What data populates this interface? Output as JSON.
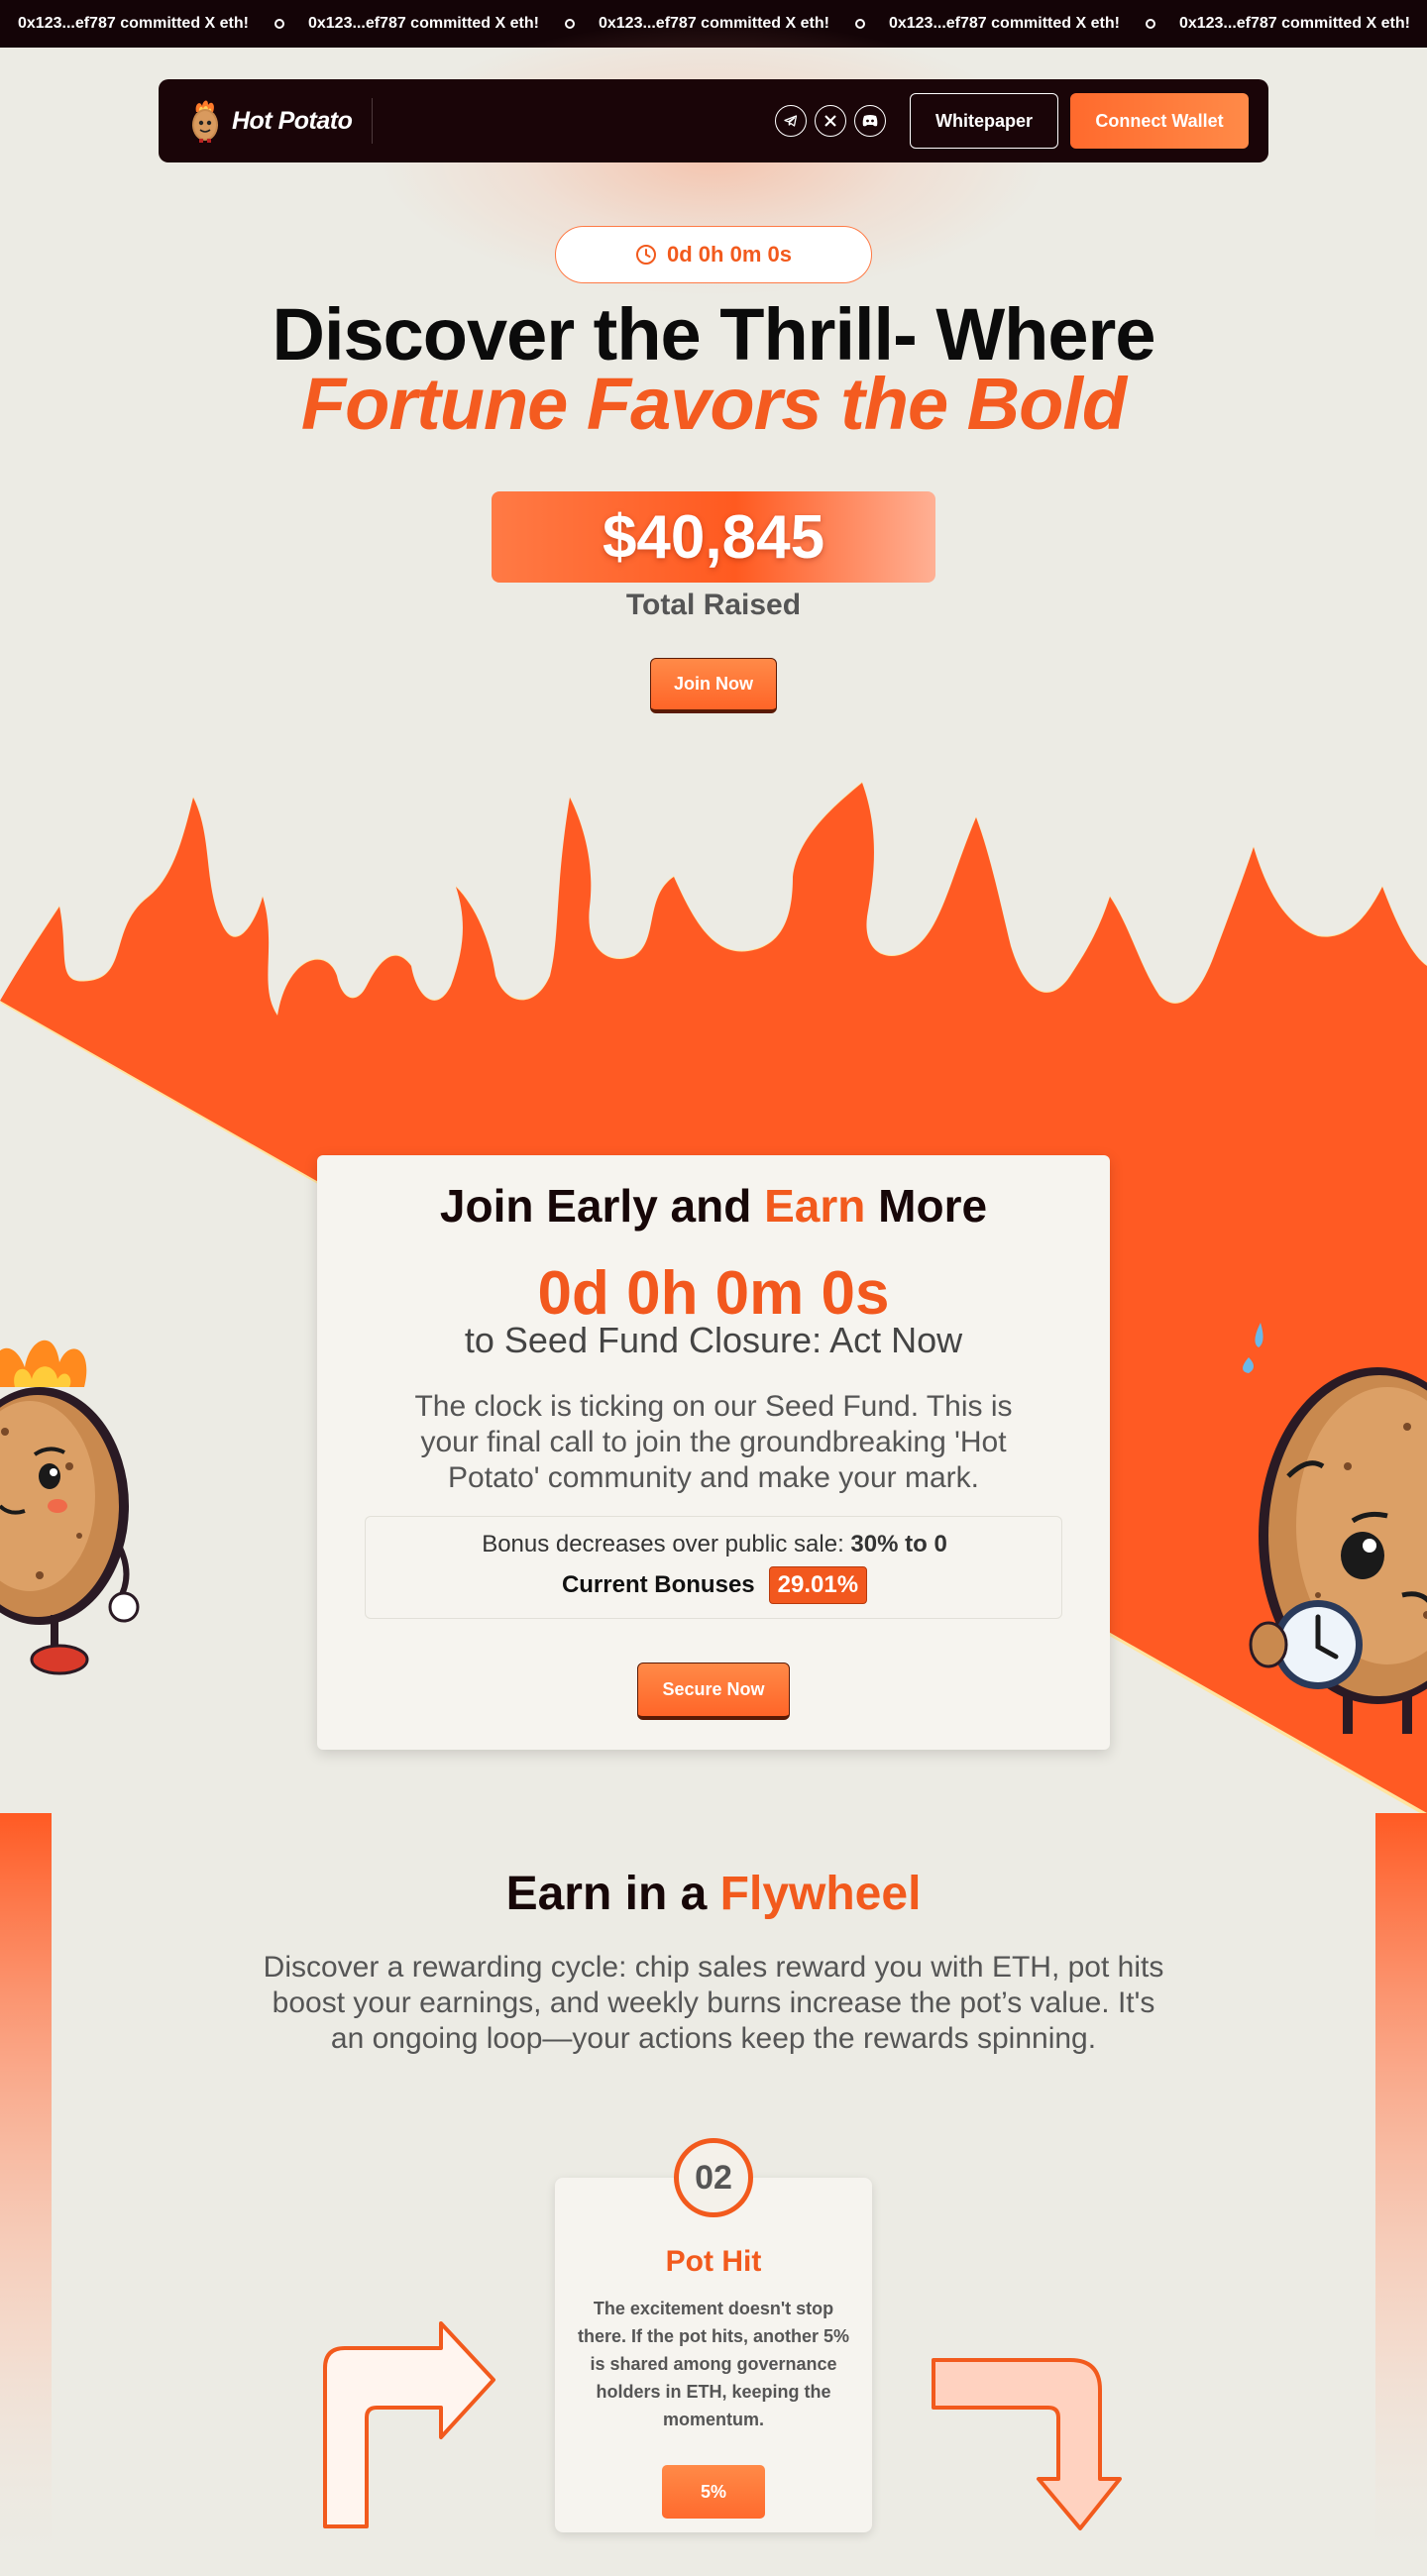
{
  "ticker": {
    "items": [
      "0x123...ef787 committed X eth!",
      "0x123...ef787 committed X eth!",
      "0x123...ef787 committed X eth!",
      "0x123...ef787 committed X eth!",
      "0x123...ef787 committed X eth!"
    ],
    "separator_icon": "circle-icon"
  },
  "nav": {
    "brand": "Hot Potato",
    "social_icons": [
      "telegram-icon",
      "x-icon",
      "discord-icon"
    ],
    "whitepaper_label": "Whitepaper",
    "connect_label": "Connect Wallet"
  },
  "hero": {
    "countdown": "0d 0h 0m 0s",
    "title_line1": "Discover the Thrill- Where",
    "title_line2": "Fortune Favors the Bold",
    "amount": "$40,845",
    "amount_label": "Total Raised",
    "join_label": "Join Now"
  },
  "seed": {
    "title_pre": "Join Early and ",
    "title_accent": "Earn",
    "title_post": " More",
    "countdown": "0d 0h 0m 0s",
    "subtitle": "to Seed Fund Closure: Act Now",
    "description": "The clock is ticking on our Seed Fund. This is your final call to join the groundbreaking 'Hot Potato' community and make your mark.",
    "bonus_text": "Bonus decreases over public sale: ",
    "bonus_range": "30% to 0",
    "current_label": "Current Bonuses",
    "current_value": "29.01%",
    "secure_label": "Secure Now"
  },
  "flywheel": {
    "title_pre": "Earn in a ",
    "title_accent": "Flywheel",
    "description": "Discover a rewarding cycle: chip sales reward you with ETH, pot hits boost your earnings, and weekly burns increase the pot’s value. It's an ongoing loop—your actions keep the rewards spinning.",
    "step": {
      "number": "02",
      "title": "Pot Hit",
      "description": "The excitement doesn't stop there. If the pot hits, another 5% is shared among governance holders in ETH, keeping the momentum.",
      "badge": "5%"
    }
  },
  "colors": {
    "accent": "#f25a1d",
    "flame": "#ff5a23",
    "dark": "#1a0508",
    "background": "#ecebe4"
  }
}
